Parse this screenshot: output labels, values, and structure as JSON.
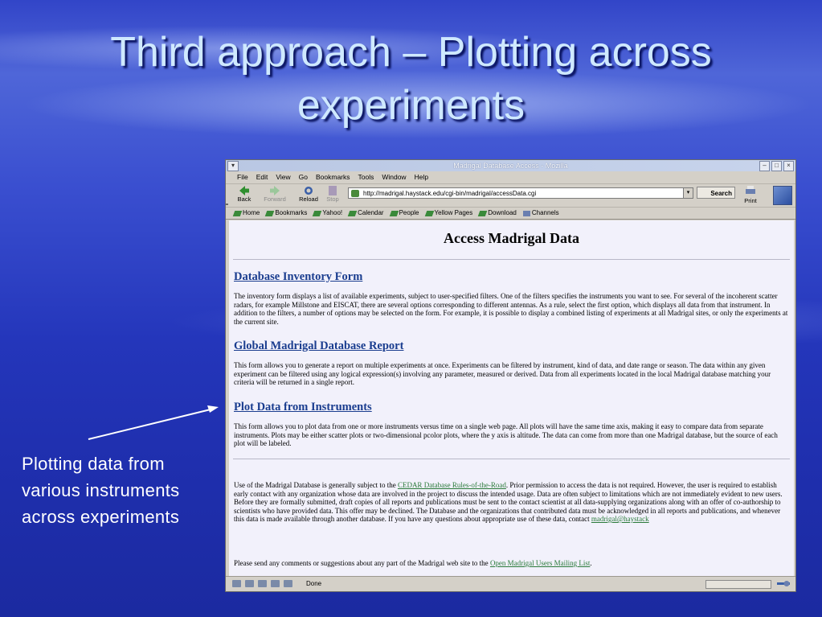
{
  "slide": {
    "title_line1": "Third approach – Plotting across",
    "title_line2": "experiments",
    "caption_lines": [
      "Plotting data from",
      "various instruments",
      "across experiments"
    ]
  },
  "browser": {
    "window_title": "Madrigal Database Access - Mozilla",
    "menu": [
      "File",
      "Edit",
      "View",
      "Go",
      "Bookmarks",
      "Tools",
      "Window",
      "Help"
    ],
    "nav": {
      "back": "Back",
      "forward": "Forward",
      "reload": "Reload",
      "stop": "Stop",
      "search": "Search",
      "print": "Print"
    },
    "url": "http://madrigal.haystack.edu/cgi-bin/madrigal/accessData.cgi",
    "bookmarks": [
      "Home",
      "Bookmarks",
      "Yahoo!",
      "Calendar",
      "People",
      "Yellow Pages",
      "Download",
      "Channels"
    ],
    "status": "Done"
  },
  "page": {
    "title": "Access Madrigal Data",
    "sections": [
      {
        "heading": "Database Inventory Form",
        "text": "The inventory form displays a list of available experiments, subject to user-specified filters. One of the filters specifies the instruments you want to see. For several of the incoherent scatter radars, for example Millstone and EISCAT, there are several options corresponding to different antennas. As a rule, select the first option, which displays all data from that instrument. In addition to the filters, a number of options may be selected on the form. For example, it is possible to display a combined listing of experiments at all Madrigal sites, or only the experiments at the current site."
      },
      {
        "heading": "Global Madrigal Database Report",
        "text": "This form allows you to generate a report on multiple experiments at once. Experiments can be filtered by instrument, kind of data, and date range or season. The data within any given experiment can be filtered using any logical expression(s) involving any parameter, measured or derived. Data from all experiments located in the local Madrigal database matching your criteria will be returned in a single report."
      },
      {
        "heading": "Plot Data from Instruments",
        "text": "This form allows you to plot data from one or more instruments versus time on a single web page.  All plots will have the same time axis, making it easy to compare data from separate instruments.  Plots may be either scatter plots or two-dimensional pcolor plots, where the y axis is altitude.  The data can come from more than one Madrigal database, but the source of each plot will be labeled."
      }
    ],
    "usage_pre": "Use of the Madrigal Database is generally subject to the ",
    "usage_link": "CEDAR Database Rules-of-the-Road",
    "usage_mid": ". Prior permission to access the data is not required. However, the user is required to establish early contact with any organization whose data are involved in the project to discuss the intended usage. Data are often subject to limitations which are not immediately evident to new users. Before they are formally submitted, draft copies of all reports and publications must be sent to the contact scientist at all data-supplying organizations along with an offer of co-authorship to scientists who have provided data. This offer may be declined. The Database and the organizations that contributed data must be acknowledged in all reports and publications, and whenever this data is made available through another database. If you have any questions about appropriate use of these data, contact ",
    "usage_email": "madrigal@haystack",
    "comments_pre": "Please send any comments or suggestions about any part of the Madrigal web site to the ",
    "comments_link": "Open Madrigal Users Mailing List",
    "comments_post": "."
  }
}
